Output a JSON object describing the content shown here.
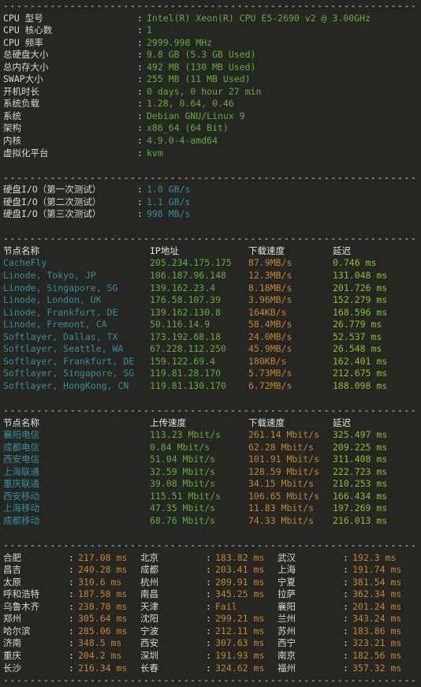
{
  "terminal": {
    "separator": "dashed-rule",
    "colors": {
      "background": "#262622",
      "text": "#d8d8d2",
      "green": "#5fb134",
      "cyan": "#35909e",
      "lime": "#8cbf26",
      "orange": "#c8852a"
    }
  },
  "sysinfo": {
    "rows": [
      {
        "label": "CPU 型号",
        "value": "Intel(R) Xeon(R) CPU E5-2690 v2 @ 3.00GHz"
      },
      {
        "label": "CPU 核心数",
        "value": "1"
      },
      {
        "label": "CPU 频率",
        "value": "2999.998 MHz"
      },
      {
        "label": "总硬盘大小",
        "value": "9.8 GB (5.3 GB Used)"
      },
      {
        "label": "总内存大小",
        "value": "492 MB (130 MB Used)"
      },
      {
        "label": "SWAP大小",
        "value": "255 MB (11 MB Used)"
      },
      {
        "label": "开机时长",
        "value": "0 days, 0 hour 27 min"
      },
      {
        "label": "系统负载",
        "value": "1.28, 0.64, 0.46"
      },
      {
        "label": "系统",
        "value": "Debian GNU/Linux 9"
      },
      {
        "label": "架构",
        "value": "x86_64 (64 Bit)"
      },
      {
        "label": "内核",
        "value": "4.9.0-4-amd64"
      },
      {
        "label": "虚拟化平台",
        "value": "kvm"
      }
    ],
    "colon": ":"
  },
  "diskio": {
    "rows": [
      {
        "label": "硬盘I/O（第一次测试）",
        "value": "1.0 GB/s"
      },
      {
        "label": "硬盘I/O（第二次测试）",
        "value": "1.1 GB/s"
      },
      {
        "label": "硬盘I/O（第三次测试）",
        "value": "998 MB/s"
      }
    ],
    "colon": ":"
  },
  "intl_speedtest": {
    "headers": [
      "节点名称",
      "IP地址",
      "下载速度",
      "延迟"
    ],
    "rows": [
      {
        "node": "CacheFly",
        "ip": "205.234.175.175",
        "download": "87.9MB/s",
        "latency": "0.746 ms"
      },
      {
        "node": "Linode, Tokyo, JP",
        "ip": "106.187.96.148",
        "download": "12.3MB/s",
        "latency": "131.048 ms"
      },
      {
        "node": "Linode, Singapore, SG",
        "ip": "139.162.23.4",
        "download": "8.18MB/s",
        "latency": "201.726 ms"
      },
      {
        "node": "Linode, London, UK",
        "ip": "176.58.107.39",
        "download": "3.96MB/s",
        "latency": "152.279 ms"
      },
      {
        "node": "Linode, Frankfurt, DE",
        "ip": "139.162.130.8",
        "download": "164KB/s",
        "latency": "168.596 ms"
      },
      {
        "node": "Linode, Fremont, CA",
        "ip": "50.116.14.9",
        "download": "58.4MB/s",
        "latency": "26.779 ms"
      },
      {
        "node": "Softlayer, Dallas, TX",
        "ip": "173.192.68.18",
        "download": "24.0MB/s",
        "latency": "52.537 ms"
      },
      {
        "node": "Softlayer, Seattle, WA",
        "ip": "67.228.112.250",
        "download": "45.9MB/s",
        "latency": "26.548 ms"
      },
      {
        "node": "Softlayer, Frankfurt, DE",
        "ip": "159.122.69.4",
        "download": "180KB/s",
        "latency": "162.401 ms"
      },
      {
        "node": "Softlayer, Singapore, SG",
        "ip": "119.81.28.170",
        "download": "5.73MB/s",
        "latency": "212.675 ms"
      },
      {
        "node": "Softlayer, HongKong, CN",
        "ip": "119.81.130.170",
        "download": "6.72MB/s",
        "latency": "188.098 ms"
      }
    ]
  },
  "cn_speedtest": {
    "headers": [
      "节点名称",
      "上传速度",
      "下载速度",
      "延迟"
    ],
    "rows": [
      {
        "node": "襄阳电信",
        "upload": "113.23 Mbit/s",
        "download": "261.14 Mbit/s",
        "latency": "325.497 ms"
      },
      {
        "node": "成都电信",
        "upload": "0.84 Mbit/s",
        "download": "62.28 Mbit/s",
        "latency": "209.225 ms"
      },
      {
        "node": "西安电信",
        "upload": "51.04 Mbit/s",
        "download": "101.91 Mbit/s",
        "latency": "311.408 ms"
      },
      {
        "node": "上海联通",
        "upload": "32.59 Mbit/s",
        "download": "128.59 Mbit/s",
        "latency": "222.723 ms"
      },
      {
        "node": "重庆联通",
        "upload": "39.08 Mbit/s",
        "download": "34.15 Mbit/s",
        "latency": "210.253 ms"
      },
      {
        "node": "西安移动",
        "upload": "115.51 Mbit/s",
        "download": "106.65 Mbit/s",
        "latency": "166.434 ms"
      },
      {
        "node": "上海移动",
        "upload": "47.35 Mbit/s",
        "download": "11.83 Mbit/s",
        "latency": "197.269 ms"
      },
      {
        "node": "成都移动",
        "upload": "68.76 Mbit/s",
        "download": "74.33 Mbit/s",
        "latency": "216.013 ms"
      }
    ]
  },
  "ping_grid": {
    "colon": ":",
    "rows": [
      [
        {
          "city": "合肥",
          "value": "217.08 ms"
        },
        {
          "city": "北京",
          "value": "183.82 ms"
        },
        {
          "city": "武汉",
          "value": "192.3 ms"
        }
      ],
      [
        {
          "city": "昌吉",
          "value": "240.28 ms"
        },
        {
          "city": "成都",
          "value": "203.41 ms"
        },
        {
          "city": "上海",
          "value": "191.74 ms"
        }
      ],
      [
        {
          "city": "太原",
          "value": "310.6 ms"
        },
        {
          "city": "杭州",
          "value": "209.91 ms"
        },
        {
          "city": "宁夏",
          "value": "381.54 ms"
        }
      ],
      [
        {
          "city": "呼和浩特",
          "value": "187.58 ms"
        },
        {
          "city": "南昌",
          "value": "345.25 ms"
        },
        {
          "city": "拉萨",
          "value": "362.34 ms"
        }
      ],
      [
        {
          "city": "乌鲁木齐",
          "value": "238.78 ms"
        },
        {
          "city": "天津",
          "value": "Fail"
        },
        {
          "city": "襄阳",
          "value": "201.24 ms"
        }
      ],
      [
        {
          "city": "郑州",
          "value": "305.64 ms"
        },
        {
          "city": "沈阳",
          "value": "299.21 ms"
        },
        {
          "city": "兰州",
          "value": "343.24 ms"
        }
      ],
      [
        {
          "city": "哈尔滨",
          "value": "285.06 ms"
        },
        {
          "city": "宁波",
          "value": "212.11 ms"
        },
        {
          "city": "苏州",
          "value": "183.86 ms"
        }
      ],
      [
        {
          "city": "济南",
          "value": "348.5 ms"
        },
        {
          "city": "西安",
          "value": "307.63 ms"
        },
        {
          "city": "西宁",
          "value": "323.21 ms"
        }
      ],
      [
        {
          "city": "重庆",
          "value": "204.2 ms"
        },
        {
          "city": "深圳",
          "value": "191.93 ms"
        },
        {
          "city": "南京",
          "value": "182.56 ms"
        }
      ],
      [
        {
          "city": "长沙",
          "value": "216.34 ms"
        },
        {
          "city": "长春",
          "value": "324.62 ms"
        },
        {
          "city": "福州",
          "value": "357.32 ms"
        }
      ]
    ]
  }
}
